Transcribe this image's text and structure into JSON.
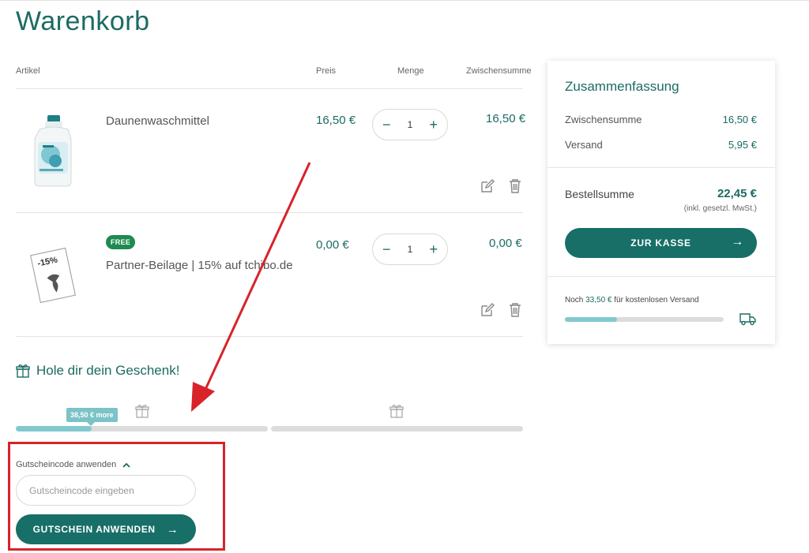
{
  "page": {
    "title": "Warenkorb"
  },
  "columns": {
    "article": "Artikel",
    "price": "Preis",
    "qty": "Menge",
    "subtotal": "Zwischensumme"
  },
  "items": [
    {
      "name": "Daunenwaschmittel",
      "price": "16,50 €",
      "qty": "1",
      "subtotal": "16,50 €",
      "badge": ""
    },
    {
      "name": "Partner-Beilage | 15% auf tchibo.de",
      "price": "0,00 €",
      "qty": "1",
      "subtotal": "0,00 €",
      "badge": "FREE",
      "coupon_text": "-15%"
    }
  ],
  "qty_controls": {
    "minus": "−",
    "plus": "+"
  },
  "gift": {
    "title": "Hole dir dein Geschenk!",
    "tooltip": "38,50 € more",
    "progress_fraction": 0.3
  },
  "coupon": {
    "label": "Gutscheincode anwenden",
    "placeholder": "Gutscheincode eingeben",
    "button": "GUTSCHEIN ANWENDEN",
    "arrow": "→"
  },
  "summary": {
    "title": "Zusammenfassung",
    "subtotal_label": "Zwischensumme",
    "subtotal_value": "16,50 €",
    "shipping_label": "Versand",
    "shipping_value": "5,95 €",
    "total_label": "Bestellsumme",
    "total_value": "22,45 €",
    "tax_note": "(inkl. gesetzl. MwSt.)",
    "checkout_label": "ZUR KASSE",
    "checkout_arrow": "→",
    "free_shipping_prefix": "Noch ",
    "free_shipping_amount": "33,50 €",
    "free_shipping_suffix": " für kostenlosen Versand",
    "free_shipping_progress": 0.33
  },
  "colors": {
    "accent": "#176f67",
    "progress": "#82c9cf",
    "highlight": "#d8232a",
    "badge": "#1e8a4f"
  }
}
